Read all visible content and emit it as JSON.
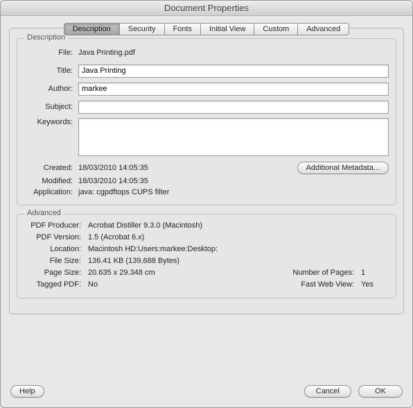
{
  "window_title": "Document Properties",
  "tabs": {
    "description": "Description",
    "security": "Security",
    "fonts": "Fonts",
    "initial_view": "Initial View",
    "custom": "Custom",
    "advanced": "Advanced"
  },
  "description": {
    "group_label": "Description",
    "labels": {
      "file": "File:",
      "title": "Title:",
      "author": "Author:",
      "subject": "Subject:",
      "keywords": "Keywords:",
      "created": "Created:",
      "modified": "Modified:",
      "application": "Application:"
    },
    "file": "Java Printing.pdf",
    "title": "Java Printing",
    "author": "markee",
    "subject": "",
    "keywords": "",
    "created": "18/03/2010 14:05:35",
    "modified": "18/03/2010 14:05:35",
    "application": "java: cgpdftops CUPS filter",
    "additional_metadata_btn": "Additional Metadata..."
  },
  "advanced": {
    "group_label": "Advanced",
    "labels": {
      "producer": "PDF Producer:",
      "version": "PDF Version:",
      "location": "Location:",
      "filesize": "File Size:",
      "pagesize": "Page Size:",
      "tagged": "Tagged PDF:",
      "numpages": "Number of Pages:",
      "fastweb": "Fast Web View:"
    },
    "producer": "Acrobat Distiller 9.3.0 (Macintosh)",
    "version": "1.5 (Acrobat 6.x)",
    "location": "Macintosh HD:Users:markee:Desktop:",
    "filesize": "136.41 KB (139,688 Bytes)",
    "pagesize": "20.635 x 29.348 cm",
    "tagged": "No",
    "numpages": "1",
    "fastweb": "Yes"
  },
  "buttons": {
    "help": "Help",
    "cancel": "Cancel",
    "ok": "OK"
  }
}
